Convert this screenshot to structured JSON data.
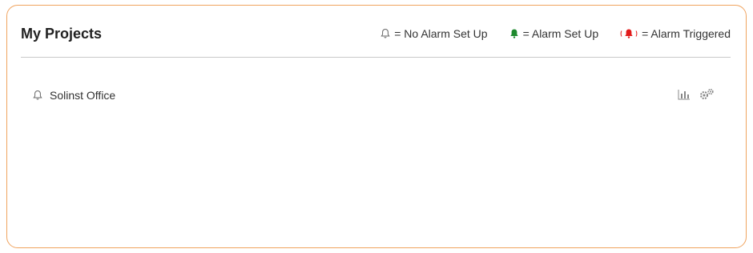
{
  "header": {
    "title": "My Projects"
  },
  "legend": {
    "no_alarm": {
      "icon": "bell-outline-icon",
      "label": "= No Alarm Set Up"
    },
    "alarm_set": {
      "icon": "bell-green-icon",
      "label": "= Alarm Set Up",
      "color": "#1e8a2e"
    },
    "alarm_triggered": {
      "icon": "bell-ringing-red-icon",
      "label": "= Alarm Triggered",
      "color": "#e21b1b"
    }
  },
  "projects": [
    {
      "name": "Solinst Office",
      "alarm_icon": "bell-outline-icon",
      "actions": [
        "chart-icon",
        "settings-gears-icon"
      ]
    }
  ],
  "colors": {
    "card_border": "#f0a35e",
    "divider": "#c9c9c9"
  }
}
